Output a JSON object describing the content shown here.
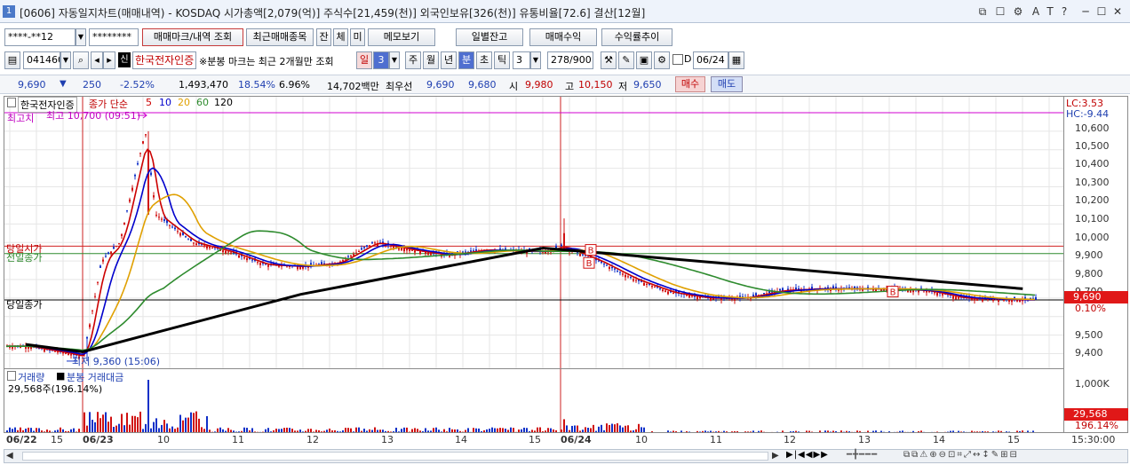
{
  "titlebar": {
    "number": "1",
    "text": "[0606] 자동일지차트(매매내역) - KOSDAQ 시가총액[2,079(억)] 주식수[21,459(천)] 외국인보유[326(천)] 유통비율[72.6] 결산[12월]",
    "controls": [
      "⧉",
      "☐",
      "⚙",
      "A",
      "T",
      "?",
      "─",
      "☐",
      "✕"
    ]
  },
  "toolbar1": {
    "account": "****-**12",
    "password": "********",
    "trade_mark_button": "매매마크/내역 조회",
    "recent_items_button": "최근매매종목",
    "tab_jan": "잔",
    "tab_che": "체",
    "tab_mi": "미",
    "memo_button": "메모보기",
    "daily_balance_button": "일별잔고",
    "trade_profit_button": "매매수익",
    "profit_trend_button": "수익률추이"
  },
  "toolbar2": {
    "code": "041460",
    "new_badge": "신",
    "stock_name": "한국전자인증",
    "notice": "※분봉 마크는 최근 2개월만 조회",
    "period_day": "일",
    "period_value": "3",
    "period_week": "주",
    "period_month": "월",
    "period_year": "년",
    "period_minute": "분",
    "period_second": "초",
    "period_tick": "틱",
    "unit_value": "3",
    "count": "278/900",
    "d_label": "D",
    "date": "06/24"
  },
  "quote": {
    "price": "9,690",
    "change": "250",
    "change_pct": "-2.52%",
    "volume": "1,493,470",
    "turnover_pct": "18.54%",
    "ratio": "6.96%",
    "amount": "14,702백만",
    "best_ask_label": "최우선",
    "best_ask": "9,690",
    "best_bid": "9,680",
    "open_label": "시",
    "open": "9,980",
    "high_label": "고",
    "high": "10,150",
    "low_label": "저",
    "low": "9,650",
    "buy_button": "매수",
    "sell_button": "매도"
  },
  "chart": {
    "legend_name": "한국전자인증",
    "legend_close": "종가 단순",
    "ma_periods": [
      "5",
      "10",
      "20",
      "60",
      "120"
    ],
    "ma_colors": [
      "#cc0000",
      "#0000cc",
      "#e0a000",
      "#2e8b2e",
      "#000000"
    ],
    "high_marker": "최고 10,700 (09:51)",
    "high_line_label": "최고치",
    "low_marker": "최저 9,360 (15:06)",
    "open_line_label": "당일시가",
    "prev_close_label": "전일종가",
    "today_close_label": "당일종가",
    "lc_label": "LC:3.53",
    "hc_label": "HC:-9.44",
    "current_price_tag": "9,690",
    "current_pct": "0.10%",
    "yticks": [
      "10,600",
      "10,500",
      "10,400",
      "10,300",
      "10,200",
      "10,100",
      "10,000",
      "9,900",
      "9,800",
      "9,700",
      "9,500",
      "9,400"
    ],
    "trade_mark_B": "B"
  },
  "volume_panel": {
    "legend_volume": "거래량",
    "legend_minute": "분봉 거래대금",
    "value_text": "29,568주(196.14%)",
    "ytick": "1,000K",
    "current_tag": "29,568",
    "current_pct": "196.14%"
  },
  "xaxis": {
    "labels": [
      {
        "t": "06/22",
        "bold": true
      },
      {
        "t": "15",
        "bold": false
      },
      {
        "t": "06/23",
        "bold": true
      },
      {
        "t": "10",
        "bold": false
      },
      {
        "t": "11",
        "bold": false
      },
      {
        "t": "12",
        "bold": false
      },
      {
        "t": "13",
        "bold": false
      },
      {
        "t": "14",
        "bold": false
      },
      {
        "t": "15",
        "bold": false
      },
      {
        "t": "06/24",
        "bold": true
      },
      {
        "t": "10",
        "bold": false
      },
      {
        "t": "11",
        "bold": false
      },
      {
        "t": "12",
        "bold": false
      },
      {
        "t": "13",
        "bold": false
      },
      {
        "t": "14",
        "bold": false
      },
      {
        "t": "15",
        "bold": false
      }
    ],
    "time": "15:30:00"
  },
  "chart_data": {
    "type": "candlestick",
    "title": "",
    "interval": "3분",
    "sessions": [
      "06/22",
      "06/23",
      "06/24"
    ],
    "price_range": [
      9350,
      10700
    ],
    "reference_levels": {
      "high": 10700,
      "low": 9360,
      "today_open": 9980,
      "prev_close": 9940,
      "today_close": 9690
    },
    "close_series": [
      {
        "time": "06/22 14:40",
        "value": 9440
      },
      {
        "time": "06/22 15:20",
        "value": 9400
      },
      {
        "time": "06/23 09:00",
        "value": 9380
      },
      {
        "time": "06/23 09:15",
        "value": 9900
      },
      {
        "time": "06/23 09:30",
        "value": 10000
      },
      {
        "time": "06/23 09:51",
        "value": 10600
      },
      {
        "time": "06/23 10:00",
        "value": 10150
      },
      {
        "time": "06/23 10:30",
        "value": 10000
      },
      {
        "time": "06/23 11:00",
        "value": 9950
      },
      {
        "time": "06/23 11:30",
        "value": 9880
      },
      {
        "time": "06/23 12:00",
        "value": 9870
      },
      {
        "time": "06/23 12:30",
        "value": 9890
      },
      {
        "time": "06/23 13:00",
        "value": 10000
      },
      {
        "time": "06/23 13:30",
        "value": 9960
      },
      {
        "time": "06/23 14:00",
        "value": 9930
      },
      {
        "time": "06/23 14:30",
        "value": 9960
      },
      {
        "time": "06/23 15:20",
        "value": 9950
      },
      {
        "time": "06/24 09:00",
        "value": 9980
      },
      {
        "time": "06/24 09:30",
        "value": 9900
      },
      {
        "time": "06/24 10:00",
        "value": 9800
      },
      {
        "time": "06/24 10:30",
        "value": 9730
      },
      {
        "time": "06/24 11:00",
        "value": 9700
      },
      {
        "time": "06/24 11:30",
        "value": 9700
      },
      {
        "time": "06/24 12:00",
        "value": 9740
      },
      {
        "time": "06/24 12:30",
        "value": 9750
      },
      {
        "time": "06/24 13:00",
        "value": 9750
      },
      {
        "time": "06/24 13:30",
        "value": 9750
      },
      {
        "time": "06/24 14:00",
        "value": 9740
      },
      {
        "time": "06/24 14:30",
        "value": 9700
      },
      {
        "time": "06/24 15:20",
        "value": 9690
      }
    ],
    "ma120_series": [
      {
        "time": "06/22 14:40",
        "value": 9450
      },
      {
        "time": "06/23 09:00",
        "value": 9410
      },
      {
        "time": "06/23 12:00",
        "value": 9720
      },
      {
        "time": "06/23 15:20",
        "value": 9970
      },
      {
        "time": "06/24 15:20",
        "value": 9750
      }
    ],
    "volume_series": [
      {
        "time": "06/23 09:51",
        "value": 1000000
      },
      {
        "time": "06/24 15:20",
        "value": 29568
      }
    ]
  }
}
